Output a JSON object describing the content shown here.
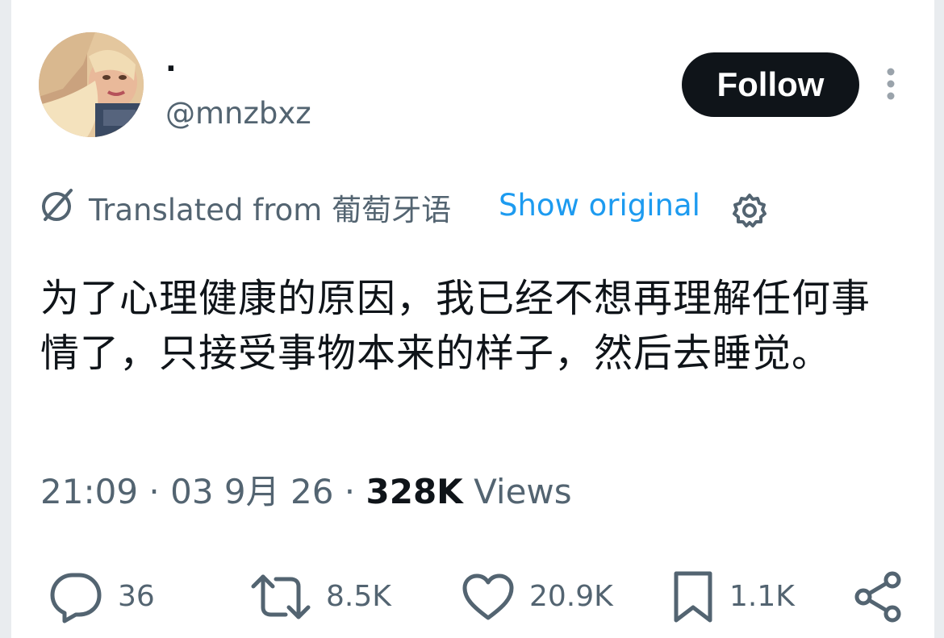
{
  "user": {
    "display_name": "·",
    "handle": "@mnzbxz",
    "avatar": "profile-photo"
  },
  "follow_button": {
    "label": "Follow"
  },
  "translation": {
    "translated_from": "Translated from 葡萄牙语",
    "show_original": "Show original"
  },
  "tweet": {
    "text": "为了心理健康的原因，我已经不想再理解任何事情了，只接受事物本来的样子，然后去睡觉。",
    "time": "21:09",
    "date": "03 9月 26",
    "separator": "·",
    "views_count": "328K",
    "views_label": "Views"
  },
  "actions": {
    "replies": {
      "icon": "reply-icon",
      "count": "36"
    },
    "reposts": {
      "icon": "repost-icon",
      "count": "8.5K"
    },
    "likes": {
      "icon": "heart-icon",
      "count": "20.9K"
    },
    "bookmarks": {
      "icon": "bookmark-icon",
      "count": "1.1K"
    },
    "share": {
      "icon": "share-icon"
    }
  },
  "colors": {
    "text_primary": "#0f1419",
    "text_secondary": "#536471",
    "link": "#1d9bf0",
    "button_bg": "#0f1419"
  }
}
